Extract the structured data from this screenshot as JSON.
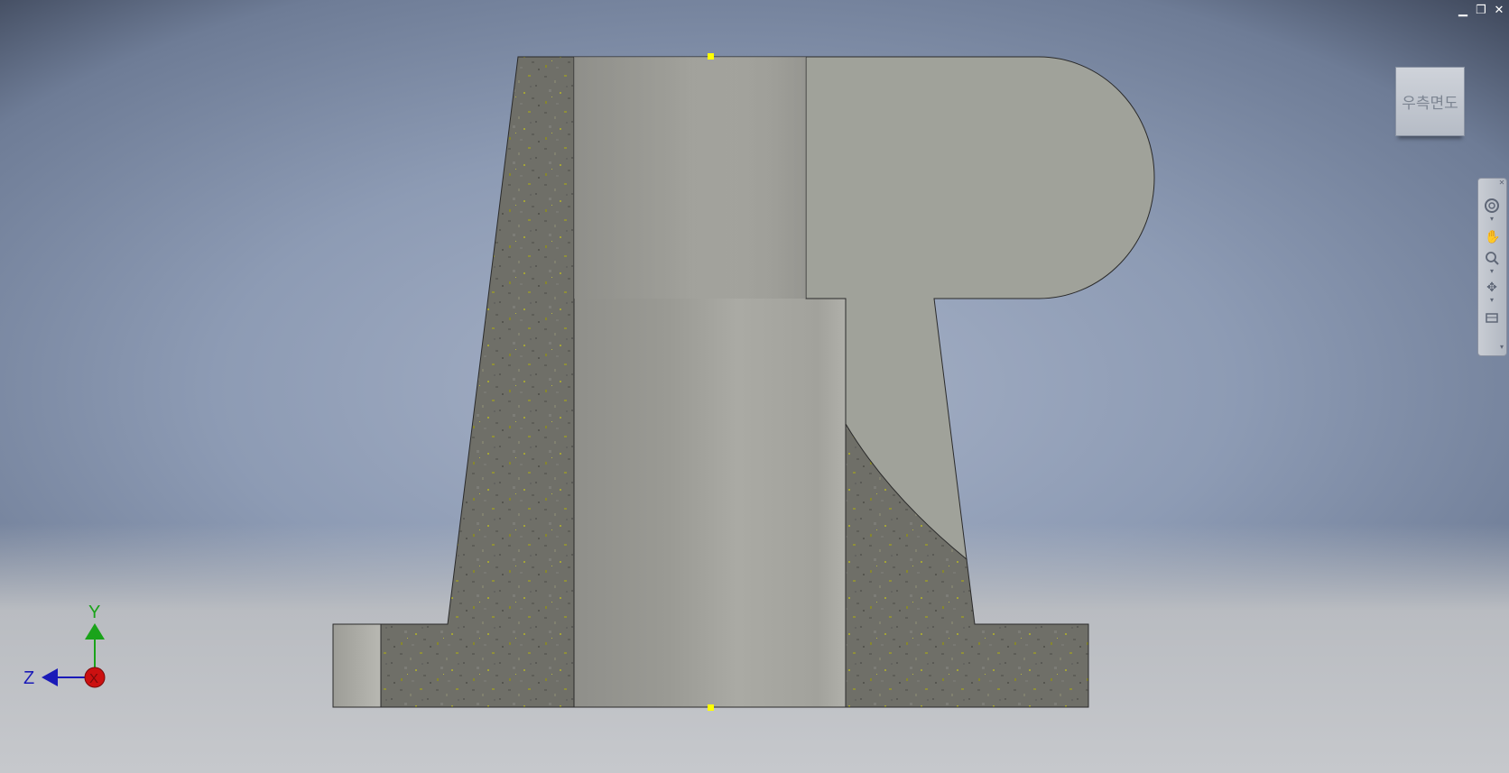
{
  "viewport": {
    "background_top": "#6e7c96",
    "background_center": "#a7b2c7",
    "floor_color": "#c6c8cc"
  },
  "window_controls": {
    "minimize_label": "▁",
    "restore_label": "❐",
    "close_label": "✕"
  },
  "viewcube": {
    "face_label": "우측면도"
  },
  "navigation_bar": {
    "close_label": "✕",
    "tools": [
      "steering-wheel-icon",
      "pan-icon",
      "zoom-icon",
      "orbit-icon",
      "look-at-icon"
    ],
    "expand_label": "▾"
  },
  "triad": {
    "y_label": "Y",
    "z_label": "Z",
    "x_label": "X",
    "y_color": "#1aa31a",
    "z_color": "#1a1ab8",
    "x_color": "#cc1010"
  },
  "model": {
    "solid_color": "#a0a29a",
    "section_color": "#6f6f68",
    "speckle_color": "#8a8a30",
    "grip_color": "#ffff00"
  }
}
